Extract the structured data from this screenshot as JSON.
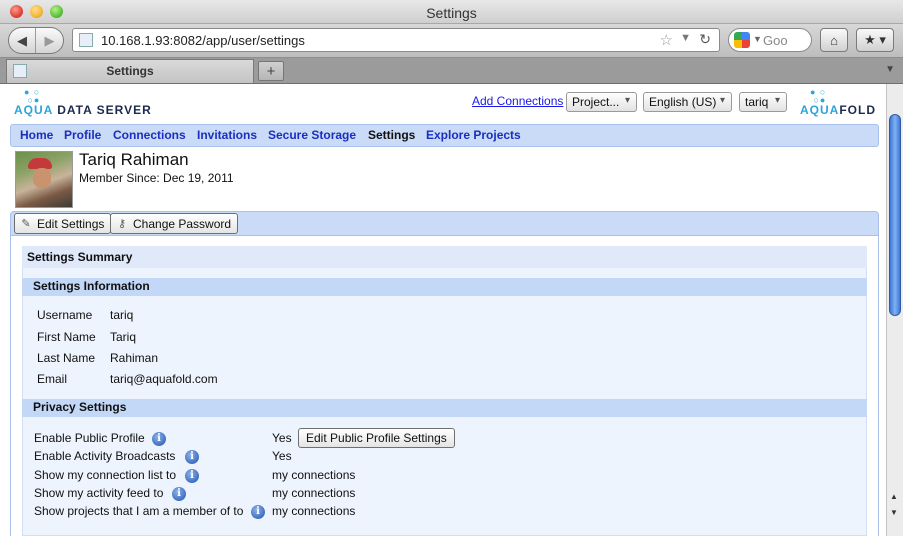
{
  "window": {
    "title": "Settings"
  },
  "browser": {
    "url": "10.168.1.93:8082/app/user/settings",
    "search_placeholder": "Goo",
    "tab_title": "Settings"
  },
  "header": {
    "logo_left": {
      "aqua": "AQUA",
      "rest": "DATA SERVER"
    },
    "logo_right": {
      "aqua": "AQUA",
      "rest": "FOLD"
    },
    "add_connections": "Add Connections",
    "project_select": "Project...",
    "language_select": "English (US)",
    "user_select": "tariq"
  },
  "nav": {
    "items": [
      {
        "label": "Home"
      },
      {
        "label": "Profile"
      },
      {
        "label": "Connections"
      },
      {
        "label": "Invitations"
      },
      {
        "label": "Secure Storage"
      },
      {
        "label": "Settings"
      },
      {
        "label": "Explore Projects"
      }
    ],
    "active": "Settings"
  },
  "profile": {
    "name": "Tariq Rahiman",
    "member_since": "Member Since: Dec 19, 2011"
  },
  "actions": {
    "edit_settings": "Edit Settings",
    "change_password": "Change Password"
  },
  "summary": {
    "title": "Settings Summary",
    "info_section": {
      "title": "Settings Information",
      "rows": [
        {
          "label": "Username",
          "value": "tariq"
        },
        {
          "label": "First Name",
          "value": "Tariq"
        },
        {
          "label": "Last Name",
          "value": "Rahiman"
        },
        {
          "label": "Email",
          "value": "tariq@aquafold.com"
        }
      ]
    },
    "privacy_section": {
      "title": "Privacy Settings",
      "rows": [
        {
          "label": "Enable Public Profile",
          "value": "Yes"
        },
        {
          "label": "Enable Activity Broadcasts",
          "value": "Yes"
        },
        {
          "label": "Show my connection list to",
          "value": "my connections"
        },
        {
          "label": "Show my activity feed to",
          "value": "my connections"
        },
        {
          "label": "Show projects that I am a member of to",
          "value": "my connections"
        }
      ],
      "public_profile_button": "Edit Public Profile Settings"
    }
  }
}
